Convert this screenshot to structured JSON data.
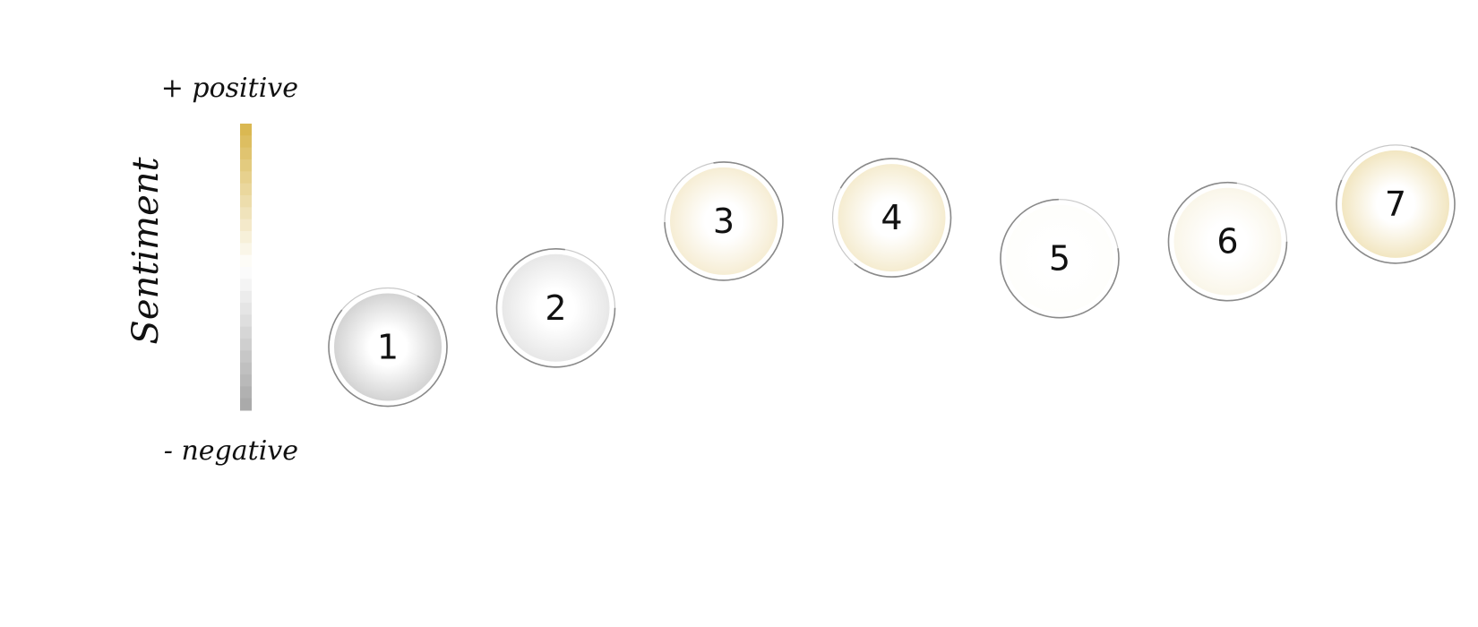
{
  "chart_data": {
    "type": "scatter",
    "title": "",
    "ylabel": "Sentiment",
    "legend": {
      "top_label": "+ positive",
      "bottom_label": "- negative",
      "placement": "left",
      "colors": [
        "#a6a6a6",
        "#ffffff",
        "#d8b54a"
      ]
    },
    "ylim": [
      -1,
      1
    ],
    "points": [
      {
        "label": "1",
        "sentiment": -0.5
      },
      {
        "label": "2",
        "sentiment": -0.27
      },
      {
        "label": "3",
        "sentiment": 0.24
      },
      {
        "label": "4",
        "sentiment": 0.26
      },
      {
        "label": "5",
        "sentiment": 0.02
      },
      {
        "label": "6",
        "sentiment": 0.12
      },
      {
        "label": "7",
        "sentiment": 0.34
      }
    ],
    "grid": false
  }
}
